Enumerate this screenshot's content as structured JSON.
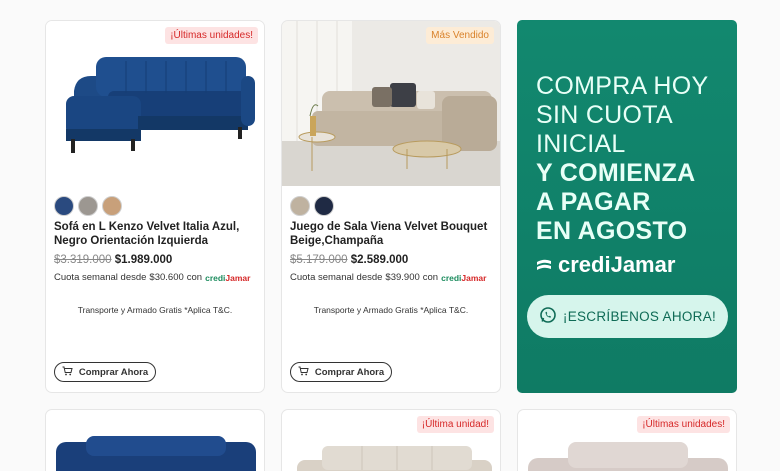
{
  "products": [
    {
      "badge": "¡Últimas unidades!",
      "title": "Sofá en L Kenzo Velvet Italia Azul, Negro Orientación Izquierda",
      "old_price": "$3.319.000",
      "new_price": "$1.989.000",
      "weekly_prefix": "Cuota semanal desde",
      "weekly_amount": "$30.600",
      "weekly_con": "con",
      "transport": "Transporte y Armado Gratis *Aplica T&C.",
      "buy_label": "Comprar Ahora",
      "swatches": [
        "#2a4a7f",
        "#9c9791",
        "#c8a07a"
      ]
    },
    {
      "badge": "Más Vendido",
      "title": "Juego de Sala Viena Velvet Bouquet Beige,Champaña",
      "old_price": "$5.179.000",
      "new_price": "$2.589.000",
      "weekly_prefix": "Cuota semanal desde",
      "weekly_amount": "$39.900",
      "weekly_con": "con",
      "transport": "Transporte y Armado Gratis *Aplica T&C.",
      "buy_label": "Comprar Ahora",
      "swatches": [
        "#bfb2a0",
        "#1f2a44"
      ]
    }
  ],
  "credi_brand": {
    "part1": "credi",
    "part2": "Jamar"
  },
  "promo": {
    "line1": "COMPRA HOY",
    "line2": "SIN CUOTA",
    "line3": "INICIAL",
    "line4": "Y COMIENZA",
    "line5": "A PAGAR",
    "line6": "EN AGOSTO",
    "brand": "crediJamar",
    "cta": "¡ESCRÍBENOS AHORA!"
  },
  "bottom_badges": [
    "¡Última unidad!",
    "¡Últimas unidades!"
  ],
  "colors": {
    "promo_bg": "#12886f",
    "badge_red": "#d62828",
    "badge_orange": "#d9822b"
  },
  "icons": [
    "cart-icon",
    "whatsapp-icon",
    "credijamar-logo"
  ]
}
